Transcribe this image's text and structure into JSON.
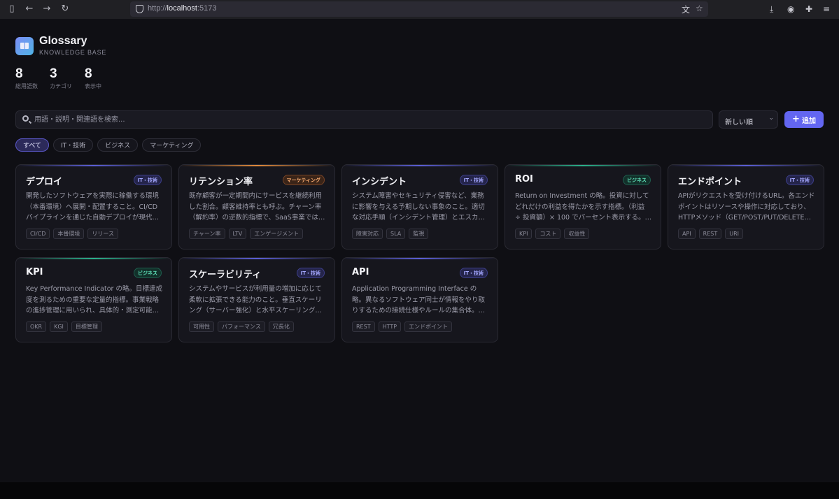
{
  "browser": {
    "url_prefix": "http://",
    "url_host": "localhost",
    "url_port": ":5173"
  },
  "app": {
    "title": "Glossary",
    "subtitle": "KNOWLEDGE BASE"
  },
  "stats": [
    {
      "value": "8",
      "label": "総用語数"
    },
    {
      "value": "3",
      "label": "カテゴリ"
    },
    {
      "value": "8",
      "label": "表示中"
    }
  ],
  "search": {
    "placeholder": "用語・説明・関連語を検索..."
  },
  "sort": {
    "selected": "新しい順"
  },
  "add_button": {
    "label": "追加"
  },
  "filters": [
    "すべて",
    "IT・技術",
    "ビジネス",
    "マーケティング"
  ],
  "colors": {
    "accent": "#6366f1",
    "it": "#a5a8ff",
    "business": "#5fe0b8",
    "marketing": "#ffb074"
  },
  "cards": [
    {
      "title": "デプロイ",
      "category": "IT・技術",
      "kind": "it",
      "desc": "開発したソフトウェアを実際に稼働する環境（本番環境）へ展開・配置すること。CI/CDパイプラインを通じた自動デプロイが現代の標準的な手法となっている。",
      "tags": [
        "CI/CD",
        "本番環境",
        "リリース"
      ]
    },
    {
      "title": "リテンション率",
      "category": "マーケティング",
      "kind": "mkt",
      "desc": "既存顧客が一定期間内にサービスを継続利用した割合。顧客維持率とも呼ぶ。チャーン率（解約率）の逆数的指標で、SaaS事業では特に重要。",
      "tags": [
        "チャーン率",
        "LTV",
        "エンゲージメント"
      ]
    },
    {
      "title": "インシデント",
      "category": "IT・技術",
      "kind": "it",
      "desc": "システム障害やセキュリティ侵害など、業務に影響を与える予期しない事象のこと。適切な対応手順（インシデント管理）とエスカレーションが必要。",
      "tags": [
        "障害対応",
        "SLA",
        "監視"
      ]
    },
    {
      "title": "ROI",
      "category": "ビジネス",
      "kind": "biz",
      "desc": "Return on Investment の略。投資に対してどれだけの利益を得たかを示す指標。（利益 ÷ 投資額）× 100 でパーセント表示する。意思決定の基準。",
      "tags": [
        "KPI",
        "コスト",
        "収益性"
      ]
    },
    {
      "title": "エンドポイント",
      "category": "IT・技術",
      "kind": "it",
      "desc": "APIがリクエストを受け付けるURL。各エンドポイントはリソースや操作に対応しており、HTTPメソッド（GET/POST/PUT/DELETE）と組み合わせて使う。",
      "tags": [
        "API",
        "REST",
        "URI"
      ]
    },
    {
      "title": "KPI",
      "category": "ビジネス",
      "kind": "biz",
      "desc": "Key Performance Indicator の略。目標達成度を測るための重要な定量的指標。事業戦略の進捗管理に用いられ、具体的・測定可能・期限付きであることが重要。",
      "tags": [
        "OKR",
        "KGI",
        "目標管理"
      ]
    },
    {
      "title": "スケーラビリティ",
      "category": "IT・技術",
      "kind": "it",
      "desc": "システムやサービスが利用量の増加に応じて柔軟に拡張できる能力のこと。垂直スケーリング（サーバー強化）と水平スケーリング（サーバー追加）がある。",
      "tags": [
        "可用性",
        "パフォーマンス",
        "冗長化"
      ]
    },
    {
      "title": "API",
      "category": "IT・技術",
      "kind": "it",
      "desc": "Application Programming Interface の略。異なるソフトウェア同士が情報をやり取りするための接続仕様やルールの集合体。Web APIが代表的。",
      "tags": [
        "REST",
        "HTTP",
        "エンドポイント"
      ]
    }
  ]
}
